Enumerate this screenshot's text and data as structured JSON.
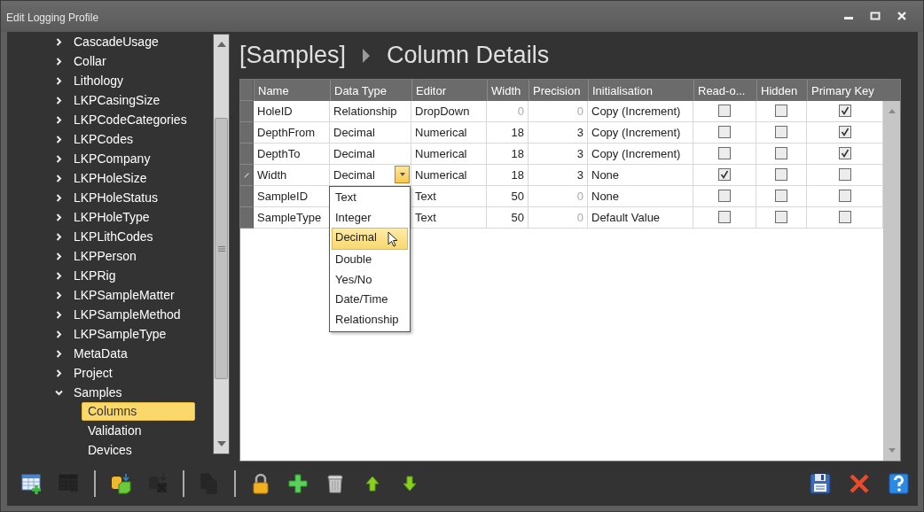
{
  "window": {
    "title": "Edit Logging Profile"
  },
  "tree": [
    {
      "label": "CascadeUsage",
      "expanded": false
    },
    {
      "label": "Collar",
      "expanded": false
    },
    {
      "label": "Lithology",
      "expanded": false
    },
    {
      "label": "LKPCasingSize",
      "expanded": false
    },
    {
      "label": "LKPCodeCategories",
      "expanded": false
    },
    {
      "label": "LKPCodes",
      "expanded": false
    },
    {
      "label": "LKPCompany",
      "expanded": false
    },
    {
      "label": "LKPHoleSize",
      "expanded": false
    },
    {
      "label": "LKPHoleStatus",
      "expanded": false
    },
    {
      "label": "LKPHoleType",
      "expanded": false
    },
    {
      "label": "LKPLithCodes",
      "expanded": false
    },
    {
      "label": "LKPPerson",
      "expanded": false
    },
    {
      "label": "LKPRig",
      "expanded": false
    },
    {
      "label": "LKPSampleMatter",
      "expanded": false
    },
    {
      "label": "LKPSampleMethod",
      "expanded": false
    },
    {
      "label": "LKPSampleType",
      "expanded": false
    },
    {
      "label": "MetaData",
      "expanded": false
    },
    {
      "label": "Project",
      "expanded": false
    },
    {
      "label": "Samples",
      "expanded": true,
      "children": [
        {
          "label": "Columns",
          "selected": true
        },
        {
          "label": "Validation",
          "selected": false
        },
        {
          "label": "Devices",
          "selected": false
        }
      ]
    }
  ],
  "heading": {
    "table": "[Samples]",
    "title": "Column Details"
  },
  "grid": {
    "columns": [
      "Name",
      "Data Type",
      "Editor",
      "Width",
      "Precision",
      "Initialisation",
      "Read-o...",
      "Hidden",
      "Primary Key"
    ],
    "rows": [
      {
        "name": "HoleID",
        "data_type": "Relationship",
        "editor": "DropDown",
        "width": {
          "text": "0",
          "dimmed": true
        },
        "precision": {
          "text": "0",
          "dimmed": true
        },
        "initialisation": "Copy (Increment)",
        "read_only": false,
        "hidden": false,
        "primary_key": true,
        "editing": false
      },
      {
        "name": "DepthFrom",
        "data_type": "Decimal",
        "editor": "Numerical",
        "width": {
          "text": "18",
          "dimmed": false
        },
        "precision": {
          "text": "3",
          "dimmed": false
        },
        "initialisation": "Copy (Increment)",
        "read_only": false,
        "hidden": false,
        "primary_key": true,
        "editing": false
      },
      {
        "name": "DepthTo",
        "data_type": "Decimal",
        "editor": "Numerical",
        "width": {
          "text": "18",
          "dimmed": false
        },
        "precision": {
          "text": "3",
          "dimmed": false
        },
        "initialisation": "Copy (Increment)",
        "read_only": false,
        "hidden": false,
        "primary_key": true,
        "editing": false
      },
      {
        "name": "Width",
        "data_type": "Decimal",
        "editor": "Numerical",
        "width": {
          "text": "18",
          "dimmed": false
        },
        "precision": {
          "text": "3",
          "dimmed": false
        },
        "initialisation": "None",
        "read_only": true,
        "hidden": false,
        "primary_key": false,
        "editing": true
      },
      {
        "name": "SampleID",
        "editor": "Text",
        "width": {
          "text": "50",
          "dimmed": false
        },
        "precision": {
          "text": "0",
          "dimmed": true
        },
        "initialisation": "None",
        "read_only": false,
        "hidden": false,
        "primary_key": false,
        "editing": false
      },
      {
        "name": "SampleType",
        "editor": "Text",
        "width": {
          "text": "50",
          "dimmed": false
        },
        "precision": {
          "text": "0",
          "dimmed": true
        },
        "initialisation": "Default Value",
        "read_only": false,
        "hidden": false,
        "primary_key": false,
        "editing": false
      }
    ],
    "dropdown": {
      "open": true,
      "options": [
        {
          "label": "Text",
          "selected": false
        },
        {
          "label": "Integer",
          "selected": false
        },
        {
          "label": "Decimal",
          "selected": true
        },
        {
          "label": "Double",
          "selected": false
        },
        {
          "label": "Yes/No",
          "selected": false
        },
        {
          "label": "Date/Time",
          "selected": false
        },
        {
          "label": "Relationship",
          "selected": false
        }
      ]
    }
  },
  "toolbar": [
    {
      "kind": "table-add",
      "disabled": false
    },
    {
      "kind": "table-delete",
      "disabled": true
    },
    {
      "kind": "separator"
    },
    {
      "kind": "import",
      "disabled": false
    },
    {
      "kind": "import-delete",
      "disabled": true
    },
    {
      "kind": "separator"
    },
    {
      "kind": "copy",
      "disabled": true
    },
    {
      "kind": "separator"
    },
    {
      "kind": "lock",
      "disabled": false
    },
    {
      "kind": "add",
      "disabled": false
    },
    {
      "kind": "delete",
      "disabled": false
    },
    {
      "kind": "up",
      "disabled": false
    },
    {
      "kind": "down",
      "disabled": false
    }
  ],
  "actions": [
    {
      "kind": "save"
    },
    {
      "kind": "cancel"
    },
    {
      "kind": "help"
    }
  ]
}
